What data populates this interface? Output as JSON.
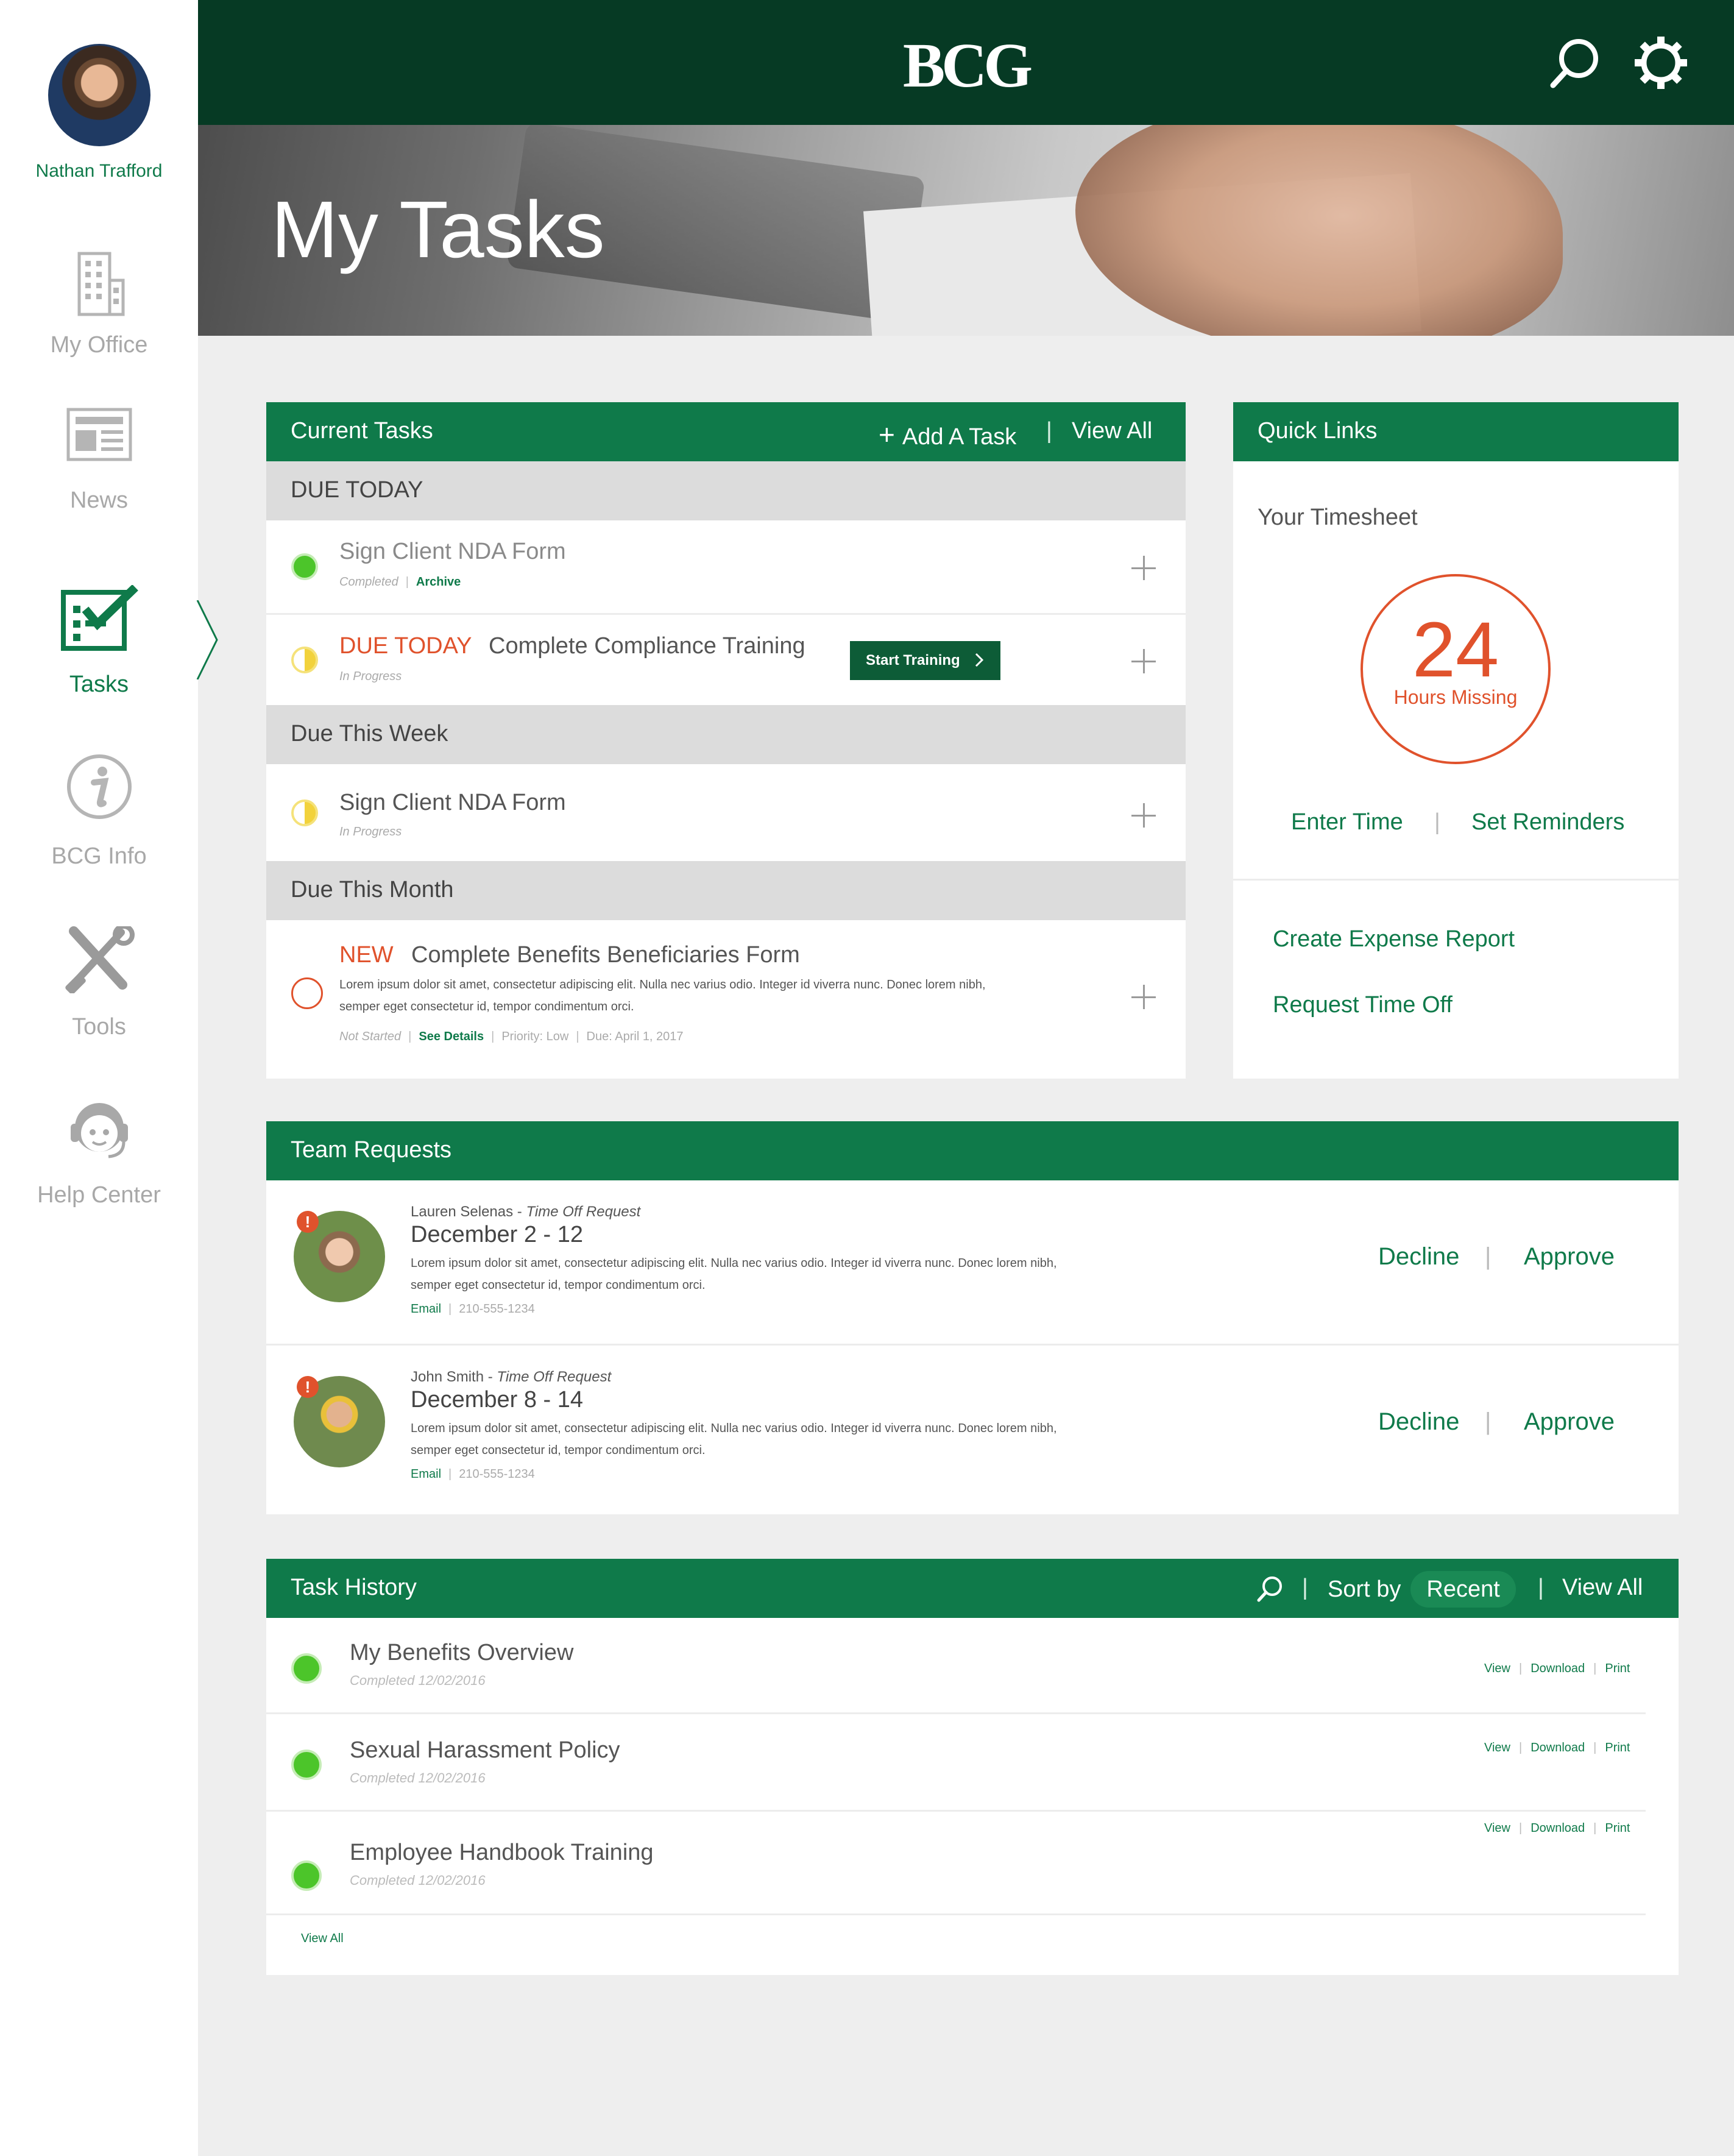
{
  "brand": "BCG",
  "page_title": "My Tasks",
  "user": {
    "name": "Nathan Trafford"
  },
  "nav": [
    {
      "label": "My Office",
      "icon": "building-icon"
    },
    {
      "label": "News",
      "icon": "newspaper-icon"
    },
    {
      "label": "Tasks",
      "icon": "checklist-icon",
      "active": true
    },
    {
      "label": "BCG Info",
      "icon": "info-icon"
    },
    {
      "label": "Tools",
      "icon": "tools-icon"
    },
    {
      "label": "Help Center",
      "icon": "headset-icon"
    }
  ],
  "current_tasks": {
    "title": "Current Tasks",
    "add_label": "Add A Task",
    "view_all": "View All",
    "sections": {
      "due_today": "DUE TODAY",
      "due_week": "Due This Week",
      "due_month": "Due This Month"
    },
    "items": [
      {
        "title": "Sign Client NDA Form",
        "status": "Completed",
        "link": "Archive"
      },
      {
        "tag": "DUE TODAY",
        "title": "Complete Compliance Training",
        "status": "In Progress",
        "button": "Start Training"
      },
      {
        "title": "Sign Client NDA Form",
        "status": "In Progress"
      },
      {
        "tag": "NEW",
        "title": "Complete Benefits Beneficiaries Form",
        "description_1": "Lorem ipsum dolor sit amet, consectetur adipiscing elit. Nulla nec varius odio. Integer id viverra nunc. Donec lorem nibh,",
        "description_2": "semper eget consectetur id, tempor condimentum orci.",
        "status": "Not Started",
        "link": "See Details",
        "priority": "Priority: Low",
        "due": "Due: April 1, 2017"
      }
    ]
  },
  "quick_links": {
    "title": "Quick Links",
    "timesheet_label": "Your Timesheet",
    "hours_missing_value": "24",
    "hours_missing_label": "Hours Missing",
    "enter_time": "Enter Time",
    "set_reminders": "Set Reminders",
    "links": [
      "Create Expense Report",
      "Request Time Off"
    ]
  },
  "team_requests": {
    "title": "Team Requests",
    "items": [
      {
        "name": "Lauren Selenas",
        "type": "Time Off Request",
        "dates": "December 2 - 12",
        "description_1": "Lorem ipsum dolor sit amet, consectetur adipiscing elit. Nulla nec varius odio. Integer id viverra nunc. Donec lorem nibh,",
        "description_2": "semper eget consectetur id, tempor condimentum orci.",
        "email": "Email",
        "phone": "210-555-1234",
        "decline": "Decline",
        "approve": "Approve"
      },
      {
        "name": "John Smith",
        "type": "Time Off Request",
        "dates": "December 8 - 14",
        "description_1": "Lorem ipsum dolor sit amet, consectetur adipiscing elit. Nulla nec varius odio. Integer id viverra nunc. Donec lorem nibh,",
        "description_2": "semper eget consectetur id, tempor condimentum orci.",
        "email": "Email",
        "phone": "210-555-1234",
        "decline": "Decline",
        "approve": "Approve"
      }
    ]
  },
  "task_history": {
    "title": "Task History",
    "sort_by": "Sort by",
    "sort_value": "Recent",
    "view_all": "View All",
    "footer_view_all": "View All",
    "actions": {
      "view": "View",
      "download": "Download",
      "print": "Print"
    },
    "items": [
      {
        "title": "My Benefits Overview",
        "meta": "Completed 12/02/2016"
      },
      {
        "title": "Sexual Harassment Policy",
        "meta": "Completed 12/02/2016"
      },
      {
        "title": "Employee Handbook Training",
        "meta": "Completed 12/02/2016"
      }
    ]
  },
  "colors": {
    "brand_green": "#0f7a4a",
    "header_dark": "#063a24",
    "alert_orange": "#e0522c",
    "complete_green": "#4cc52a"
  }
}
